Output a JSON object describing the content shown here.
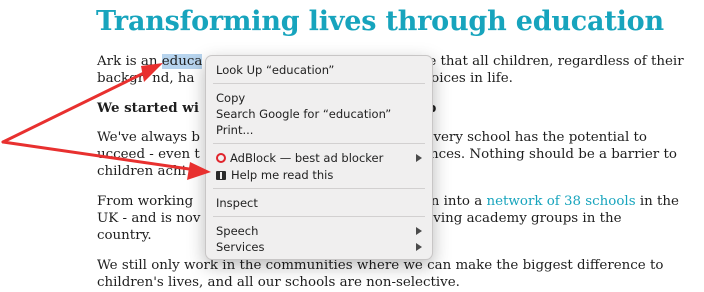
{
  "article": {
    "heading": "Transforming lives through education",
    "p1_line1_a": "Ark is an ",
    "p1_selected_word": "educa",
    "p1_line1_b": "e that all children, regardless of their",
    "p1_line2_a": "backgr",
    "p1_line2_b": "nd, ha",
    "p1_line2_c": "al choices in life.",
    "p2_line1": "We started wi",
    "p2_line1_end": "p",
    "p3_line1_a": "We've always b",
    "p3_line1_b": ", every school has the potential to",
    "p3_line2_a": "ucceed - even t",
    "p3_line2_b": "stances. Nothing should be a barrier to",
    "p3_line3": "children achi",
    "p4_line1_a": "From working",
    "p4_line1_b": "own into a ",
    "p4_link": "network of 38 schools",
    "p4_line1_c": " in the",
    "p4_line2_a": "UK - and is nov",
    "p4_line2_b": "hieving academy groups in the",
    "p4_line3": "country.",
    "p5_line1": "We still only work in the communities where we can make the biggest difference to",
    "p5_line2": "children's lives, and all our schools are non-selective."
  },
  "context_menu": {
    "look_up": "Look Up “education”",
    "copy": "Copy",
    "search_google": "Search Google for “education”",
    "print": "Print...",
    "adblock": "AdBlock — best ad blocker",
    "help_read": "Help me read this",
    "inspect": "Inspect",
    "speech": "Speech",
    "services": "Services"
  },
  "colors": {
    "heading": "#17a4bd",
    "selection": "#b7d4ee",
    "annotation_arrow": "#e8302f",
    "adblock_icon": "#e0242c"
  }
}
